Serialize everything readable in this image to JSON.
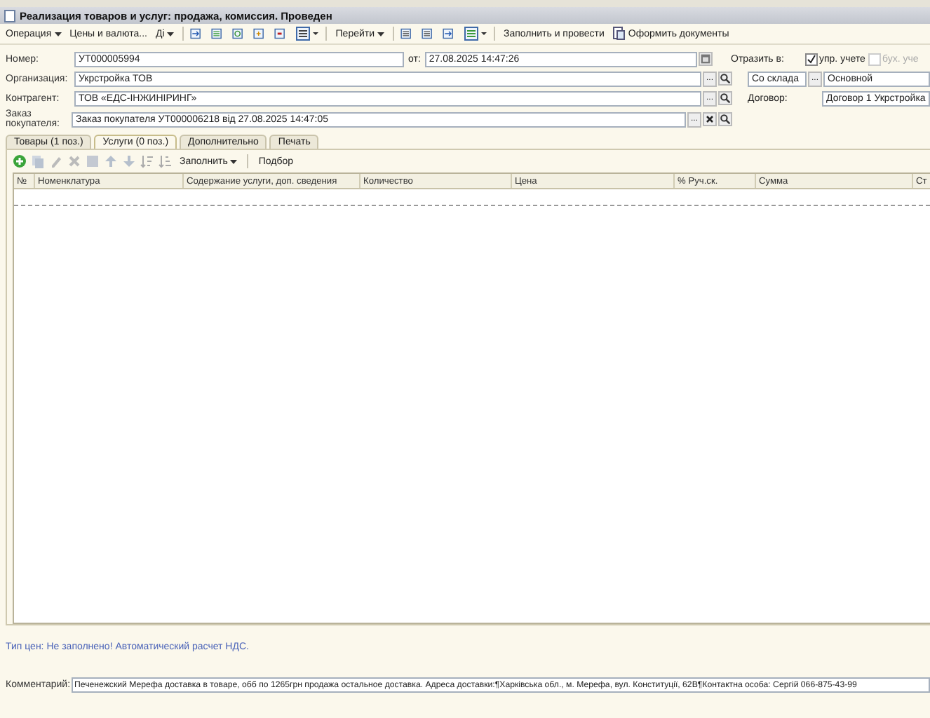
{
  "window": {
    "title": "Реализация товаров и услуг: продажа, комиссия. Проведен"
  },
  "toolbar": [
    {
      "kind": "menu",
      "label": "Операция"
    },
    {
      "kind": "button",
      "label": "Цены и валюта..."
    },
    {
      "kind": "menu",
      "label": "Ді"
    },
    {
      "kind": "icon"
    },
    {
      "kind": "icon"
    },
    {
      "kind": "icon"
    },
    {
      "kind": "icon"
    },
    {
      "kind": "icon"
    },
    {
      "kind": "icon-menu"
    },
    {
      "kind": "menu",
      "label": "Перейти"
    },
    {
      "kind": "icon"
    },
    {
      "kind": "icon"
    },
    {
      "kind": "icon"
    },
    {
      "kind": "icon-menu"
    },
    {
      "kind": "button",
      "label": "Заполнить и провести"
    },
    {
      "kind": "icon-button",
      "label": "Оформить документы"
    }
  ],
  "form": {
    "number": {
      "label": "Номер:",
      "value": "УТ000005994"
    },
    "date": {
      "label": "от:",
      "value": "27.08.2025 14:47:26"
    },
    "organization": {
      "label": "Организация:",
      "value": "Укрстройка ТОВ",
      "select_button": "..."
    },
    "counterparty": {
      "label": "Контрагент:",
      "value": "ТОВ «ЕДС-ІНЖИНІРИНГ»",
      "select_button": "..."
    },
    "order": {
      "label": "Заказ покупателя:",
      "value": "Заказ покупателя УТ000006218 від 27.08.2025 14:47:05",
      "select_button": "..."
    },
    "reflect": {
      "label": "Отразить в:",
      "options": [
        {
          "label": "упр. учете",
          "checked": true,
          "disabled": false
        },
        {
          "label": "бух. уче",
          "checked": false,
          "disabled": true
        }
      ]
    },
    "source": {
      "value": "Со склада",
      "select_button": "..."
    },
    "warehouse": {
      "value": "Основной"
    },
    "contract": {
      "label": "Договор:",
      "value": "Договор 1 Укрстройка"
    }
  },
  "tabs": [
    {
      "label": "Товары (1 поз.)",
      "selected": false
    },
    {
      "label": "Услуги (0 поз.)",
      "selected": true
    },
    {
      "label": "Дополнительно",
      "selected": false
    },
    {
      "label": "Печать",
      "selected": false
    }
  ],
  "table_toolbar": {
    "fill": "Заполнить",
    "pick": "Подбор"
  },
  "table": {
    "columns": [
      "№",
      "Номенклатура",
      "Содержание услуги, доп. сведения",
      "Количество",
      "Цена",
      "% Руч.ск.",
      "Сумма",
      "Ст"
    ]
  },
  "status": "Тип цен: Не заполнено! Автоматический расчет НДС.",
  "comment": {
    "label": "Комментарий:",
    "value": "Печенежский Мерефа доставка в товаре, обб по 1265грн продажа остальное доставка. Адреса доставки:¶Харківська обл., м. Мерефа, вул. Конституції, 62В¶Контактна особа: Сергій 066-875-43-99"
  }
}
